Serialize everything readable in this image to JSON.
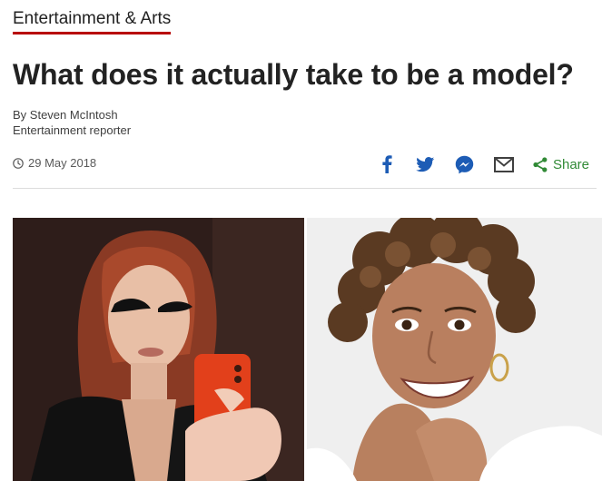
{
  "section": {
    "label": "Entertainment & Arts"
  },
  "article": {
    "headline": "What does it actually take to be a model?",
    "byline": "By Steven McIntosh",
    "author_role": "Entertainment reporter",
    "date": "29 May 2018"
  },
  "share": {
    "label": "Share",
    "icons": [
      "facebook-icon",
      "twitter-icon",
      "messenger-icon",
      "email-icon",
      "share-icon"
    ]
  },
  "colors": {
    "section_underline": "#b80000",
    "share_green": "#318a36",
    "social_blue": "#1d5cb5",
    "messenger_blue": "#0084ff",
    "text": "#222222"
  },
  "images": [
    {
      "name": "photo-model-selfie",
      "description_icon": "photo"
    },
    {
      "name": "photo-model-smiling",
      "description_icon": "photo"
    }
  ]
}
